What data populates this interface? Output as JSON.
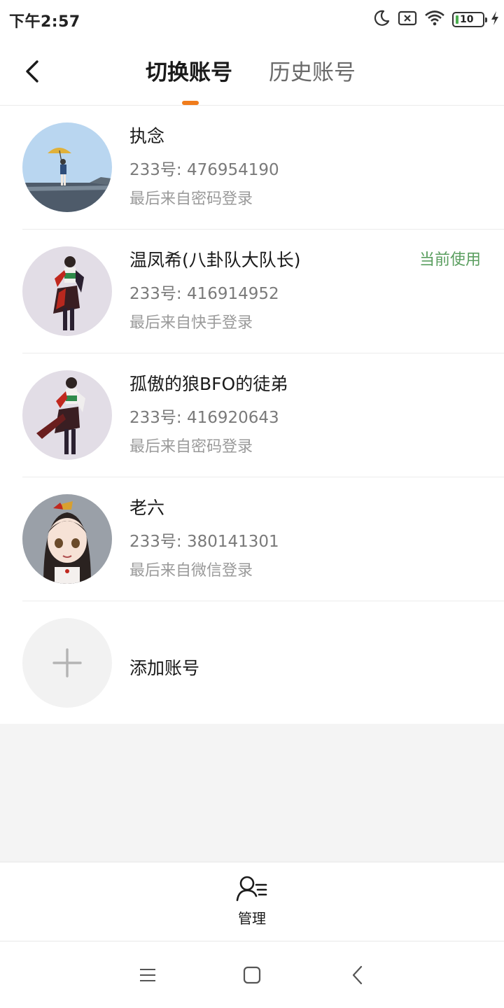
{
  "status_bar": {
    "time": "下午2:57",
    "battery_level": "10",
    "icons": [
      "moon-icon",
      "no-sim-icon",
      "wifi-icon",
      "battery-icon",
      "charging-bolt-icon"
    ]
  },
  "nav": {
    "back_icon": "chevron-left-icon",
    "tabs": [
      {
        "label": "切换账号",
        "active": true
      },
      {
        "label": "历史账号",
        "active": false
      }
    ],
    "accent_color": "#f07c1c"
  },
  "accounts": [
    {
      "name": "执念",
      "id_text": "233号: 476954190",
      "login_text": "最后来自密码登录",
      "current": false
    },
    {
      "name": "温凤希(八卦队大队长)",
      "id_text": "233号: 416914952",
      "login_text": "最后来自快手登录",
      "current": true,
      "current_label": "当前使用"
    },
    {
      "name": "孤傲的狼BFO的徒弟",
      "id_text": "233号: 416920643",
      "login_text": "最后来自密码登录",
      "current": false
    },
    {
      "name": "老六",
      "id_text": "233号: 380141301",
      "login_text": "最后来自微信登录",
      "current": false
    }
  ],
  "add_account": {
    "label": "添加账号",
    "icon": "plus-icon"
  },
  "bottom_bar": {
    "manage_label": "管理",
    "manage_icon": "user-manage-icon"
  },
  "system_nav": {
    "icons": [
      "menu-icon",
      "home-square-icon",
      "back-chevron-icon"
    ]
  },
  "colors": {
    "current_badge": "#5a9e5f",
    "text_primary": "#1a1a1a",
    "text_secondary": "#7a7a7a"
  }
}
